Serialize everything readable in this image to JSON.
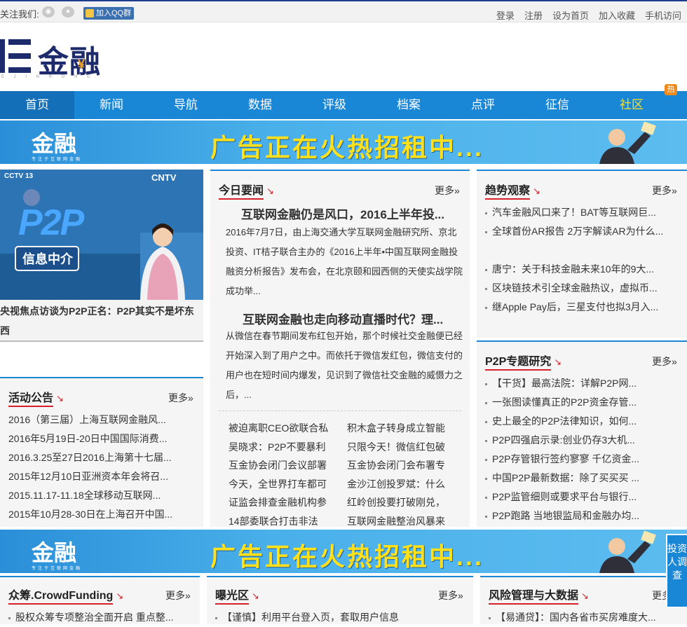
{
  "topbar": {
    "follow": "关注我们:",
    "weibo_icon": "weibo-icon",
    "wechat_icon": "wechat-icon",
    "qq": "加入QQ群",
    "links": [
      "登录",
      "注册",
      "设为首页",
      "加入收藏",
      "手机访问"
    ]
  },
  "logo": {
    "text": "金融",
    "yen": "¥",
    "sub": "E J I N R O N G"
  },
  "nav": {
    "items": [
      "首页",
      "新闻",
      "导航",
      "数据",
      "评级",
      "档案",
      "点评",
      "征信",
      "社区"
    ],
    "hot_badge": "热"
  },
  "banner": {
    "logo": "金融",
    "logo_sub": "专注于互联网金融",
    "text": "广告正在火热招租中..."
  },
  "feature": {
    "img_cctv": "CCTV 13",
    "img_cntv": "CNTV",
    "img_p2p": "P2P",
    "img_label": "信息中介",
    "caption": "央视焦点访谈为P2P正名：P2P其实不是坏东西"
  },
  "today": {
    "title": "今日要闻",
    "more": "更多»",
    "h1": "互联网金融仍是风口，2016上半年投...",
    "p1": "2016年7月7日，由上海交通大学互联网金融研究所、京北投资、IT桔子联合主办的《2016上半年•中国互联网金融投融资分析报告》发布会，在北京颐和园西侧的天使实战学院成功举...",
    "h2": "互联网金融也走向移动直播时代？理...",
    "p2": "从微信在春节期间发布红包开始，那个时候社交金融便已经开始深入到了用户之中。而依托于微信发红包，微信支付的用户也在短时间内爆发，见识到了微信社交金融的威慑力之后，...",
    "left_list": [
      "被迫离职CEO欲联合私",
      "吴晓求：P2P不要暴利",
      "互金协会闭门会议部署",
      "今天，全世界打车都可",
      "证监会排查金融机构参",
      "14部委联合打击非法"
    ],
    "right_list": [
      "积木盒子转身成立智能",
      "只限今天！微信红包破",
      "互金协会闭门会布署专",
      "金沙江创投罗斌：什么",
      "红岭创投要打破刚兑，",
      "互联网金融整治风暴来"
    ]
  },
  "trend": {
    "title": "趋势观察",
    "more": "更多»",
    "items": [
      "汽车金融风口来了！BAT等互联网巨...",
      "全球首份AR报告 2万字解读AR为什么...",
      "唐宁：关于科技金融未来10年的9大...",
      "区块链技术引全球金融热议，虚拟币...",
      "继Apple Pay后，三星支付也拟3月入..."
    ]
  },
  "activity": {
    "title": "活动公告",
    "more": "更多»",
    "items": [
      "2016（第三届）上海互联网金融风...",
      "2016年5月19日-20日中国国际消费...",
      "2016.3.25至27日2016上海第十七届...",
      "2015年12月10日亚洲资本年会将召...",
      "2015.11.17-11.18全球移动互联网...",
      "2015年10月28-30日在上海召开中国..."
    ]
  },
  "p2p": {
    "title": "P2P专题研究",
    "more": "更多»",
    "items": [
      "【干货】最高法院：详解P2P网...",
      "一张图读懂真正的P2P资金存管...",
      "史上最全的P2P法律知识，如何...",
      "P2P四强启示录:创业仍存3大机...",
      "P2P存管银行签约寥寥 千亿资金...",
      "中国P2P最新数据：除了买买买 ...",
      "P2P监管细则或要求平台与银行...",
      "P2P跑路 当地银监局和金融办均..."
    ]
  },
  "crowd": {
    "title": "众筹.CrowdFunding",
    "more": "更多»",
    "items": [
      "股权众筹专项整治全面开启 重点整..."
    ]
  },
  "expose": {
    "title": "曝光区",
    "more": "更多»",
    "items": [
      "【谨慎】利用平台登入页，套取用户信息"
    ]
  },
  "risk": {
    "title": "风险管理与大数据",
    "more": "更多»",
    "items": [
      "【易通贷】：国内各省市买房难度大..."
    ]
  },
  "survey": {
    "text": "投资人调查"
  }
}
